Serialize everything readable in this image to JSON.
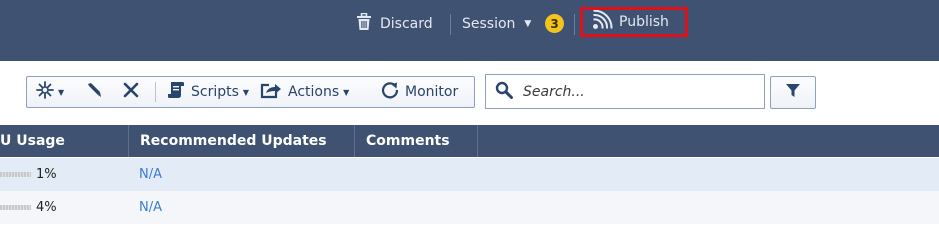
{
  "header": {
    "discard_label": "Discard",
    "session_label": "Session",
    "session_badge": "3",
    "publish_label": "Publish"
  },
  "toolbar": {
    "scripts_label": "Scripts",
    "actions_label": "Actions",
    "monitor_label": "Monitor"
  },
  "search": {
    "placeholder": "Search..."
  },
  "table": {
    "columns": [
      "U Usage",
      "Recommended Updates",
      "Comments"
    ],
    "rows": [
      {
        "usage": "1%",
        "usage_fraction": 0.01,
        "recommended_updates": "N/A",
        "comments": ""
      },
      {
        "usage": "4%",
        "usage_fraction": 0.04,
        "recommended_updates": "N/A",
        "comments": ""
      }
    ]
  },
  "colors": {
    "header_bg": "#3f5272",
    "badge": "#f3c31f",
    "publish_highlight": "#e0101a",
    "link": "#3a7fd0",
    "row_selected": "#e3ebf6"
  },
  "icons": [
    "trash-icon",
    "chevron-down-icon",
    "rss-feed-icon",
    "new-sparkle-icon",
    "pencil-icon",
    "close-icon",
    "script-icon",
    "export-icon",
    "refresh-icon",
    "search-icon",
    "filter-icon"
  ]
}
